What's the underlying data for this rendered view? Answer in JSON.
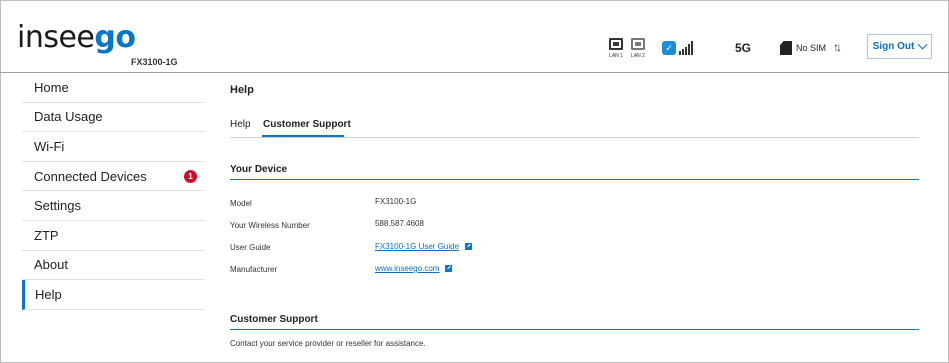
{
  "header": {
    "logo_left": "insee",
    "logo_right": "go",
    "model": "FX3100-1G",
    "lan1": "LAN 1",
    "lan2": "LAN 2",
    "network": "5G",
    "sim": "No SIM",
    "activity": "↑↓",
    "sign_out": "Sign Out"
  },
  "sidebar": {
    "items": [
      {
        "label": "Home"
      },
      {
        "label": "Data Usage"
      },
      {
        "label": "Wi-Fi"
      },
      {
        "label": "Connected Devices",
        "badge": "1"
      },
      {
        "label": "Settings"
      },
      {
        "label": "ZTP"
      },
      {
        "label": "About"
      },
      {
        "label": "Help",
        "active": true
      }
    ]
  },
  "main": {
    "title": "Help",
    "tabs": [
      {
        "label": "Help"
      },
      {
        "label": "Customer Support",
        "active": true
      }
    ],
    "device_section": {
      "title": "Your Device",
      "rows": [
        {
          "label": "Model",
          "value": "FX3100-1G"
        },
        {
          "label": "Your Wireless Number",
          "value": "588.587.4608"
        },
        {
          "label": "User Guide",
          "value": "FX3100-1G User Guide",
          "link": true
        },
        {
          "label": "Manufacturer",
          "value": "www.inseego.com",
          "link": true
        }
      ]
    },
    "support_section": {
      "title": "Customer Support",
      "text": "Contact your service provider or reseller for assistance."
    }
  },
  "colors": {
    "accent": "#0a76c7",
    "badge": "#c8102e"
  }
}
